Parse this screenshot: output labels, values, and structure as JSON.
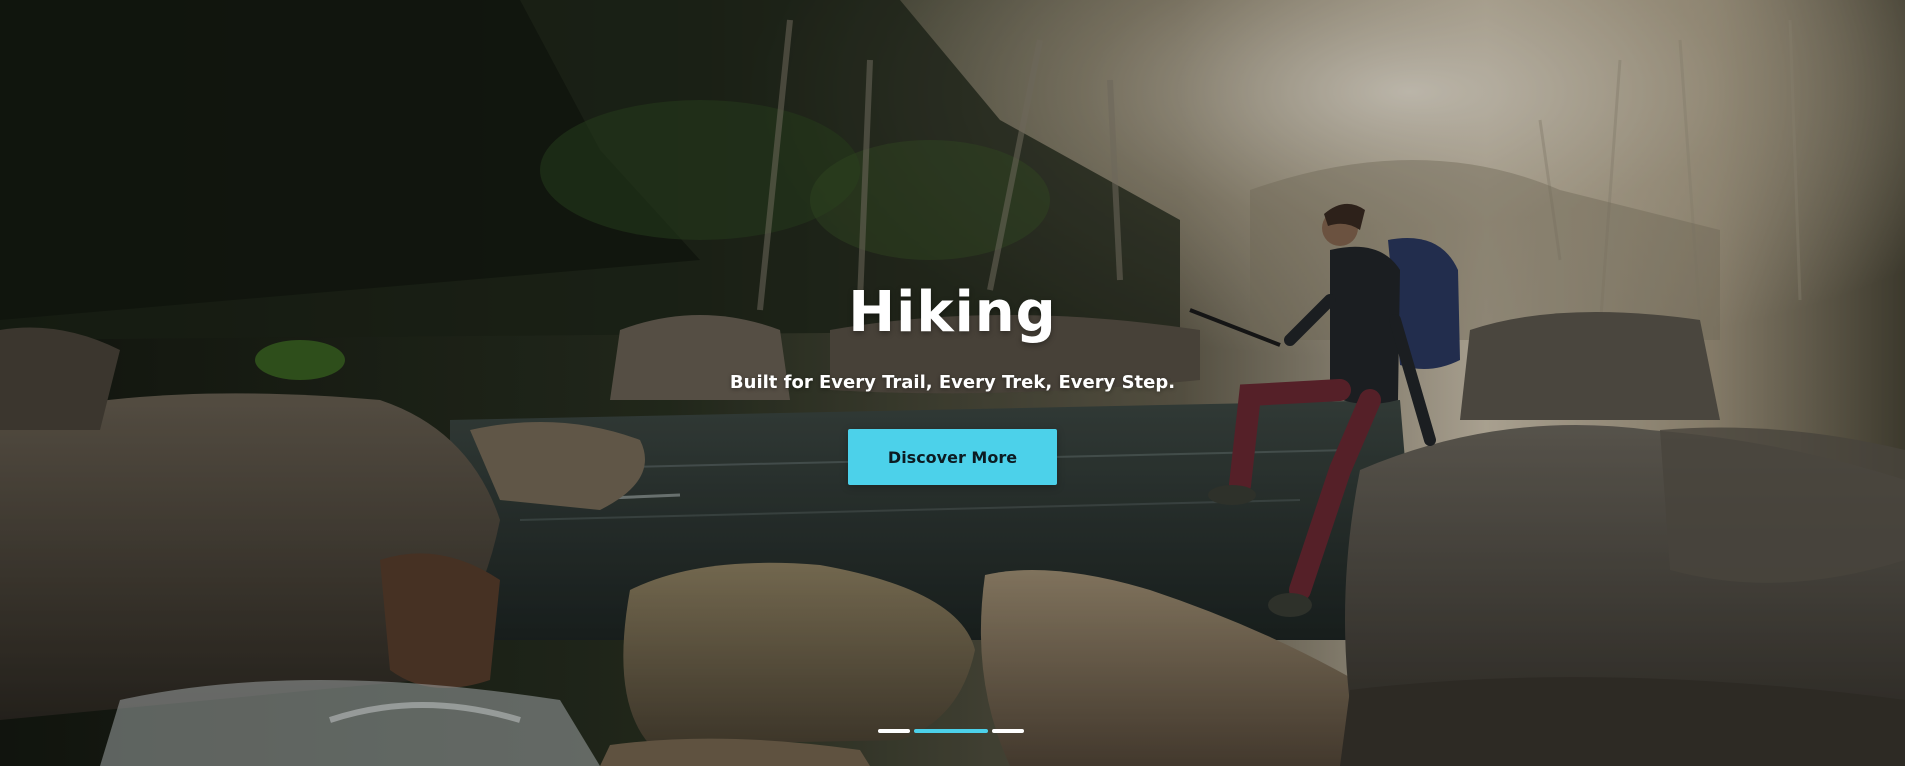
{
  "hero": {
    "title": "Hiking",
    "subtitle": "Built for Every Trail, Every Trek, Every Step.",
    "cta_label": "Discover More",
    "accent_color": "#4cd1ea",
    "background_image": "hiker-crossing-river-rocks-in-forest"
  },
  "carousel": {
    "slide_count": 3,
    "active_index": 1
  }
}
